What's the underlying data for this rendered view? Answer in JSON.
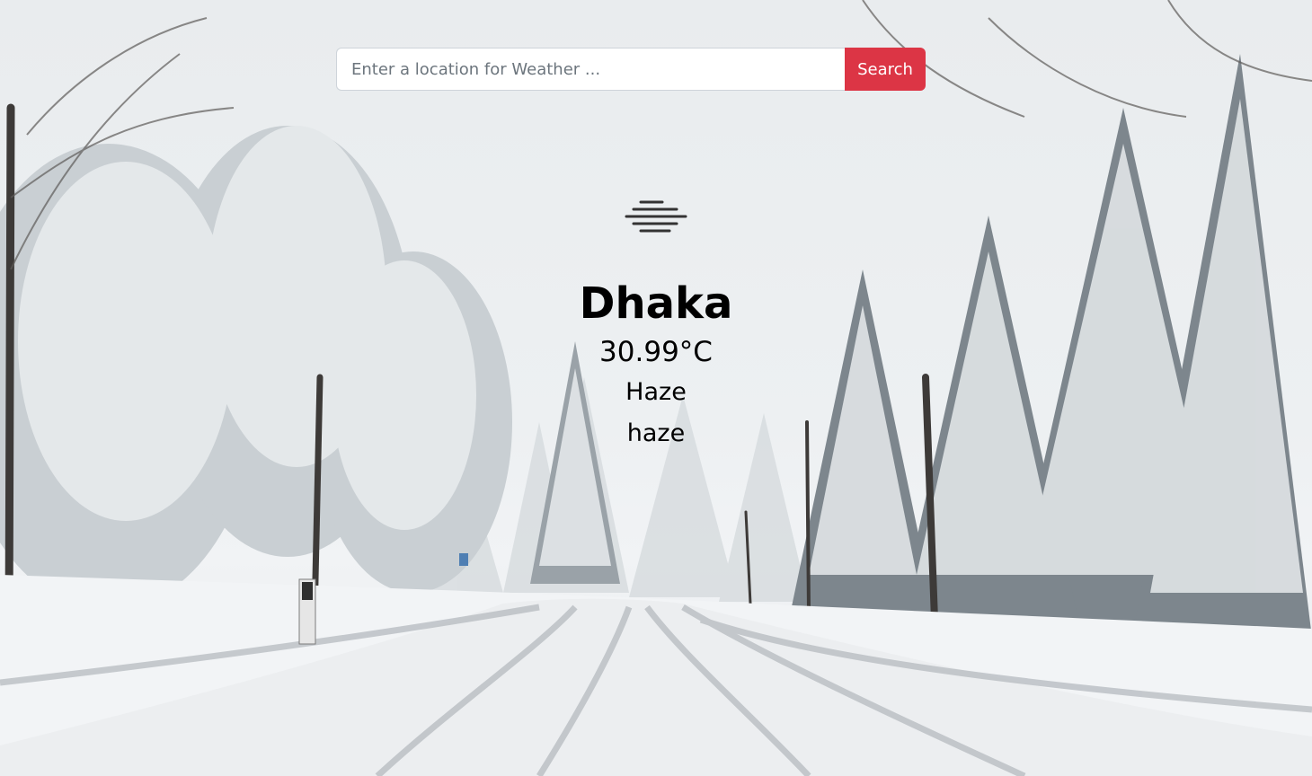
{
  "search": {
    "placeholder": "Enter a location for Weather ...",
    "value": "",
    "button_label": "Search",
    "button_color": "#dc3545"
  },
  "weather": {
    "icon": "haze-icon",
    "city": "Dhaka",
    "temperature": "30.99°C",
    "main": "Haze",
    "description": "haze"
  }
}
